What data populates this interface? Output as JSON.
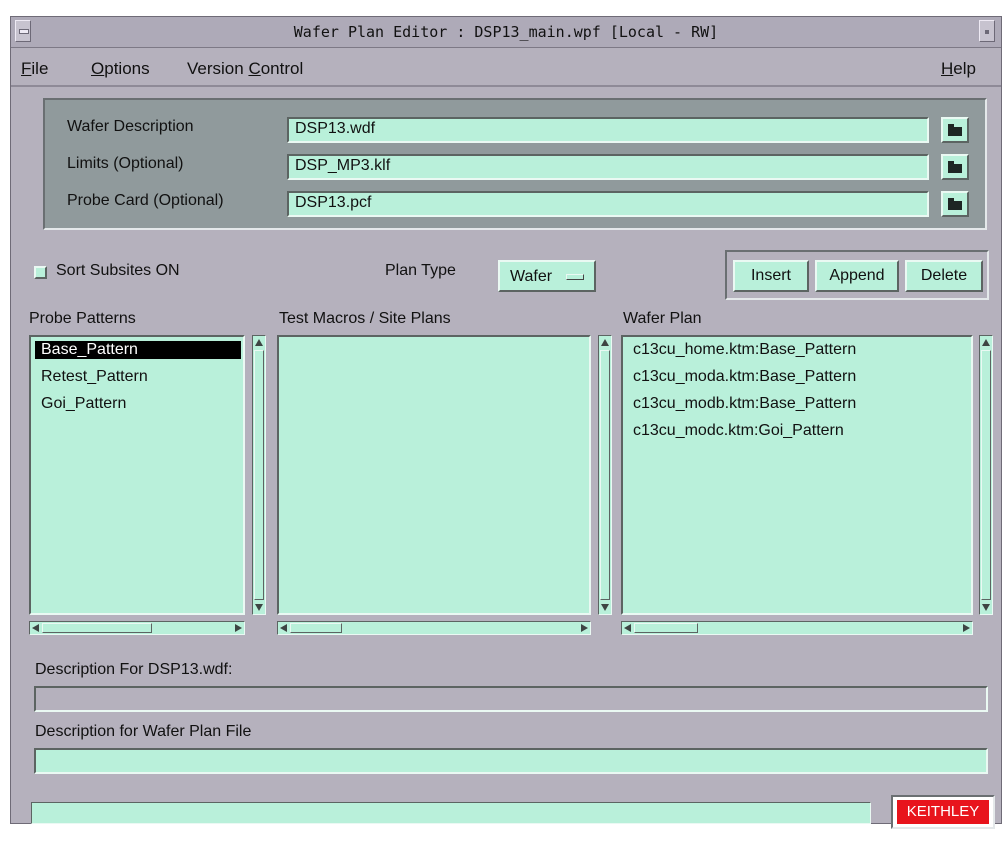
{
  "window": {
    "title": "Wafer Plan Editor : DSP13_main.wpf [Local - RW]"
  },
  "menu": {
    "file": {
      "mnemonic": "F",
      "rest": "ile"
    },
    "options": {
      "mnemonic": "O",
      "rest": "ptions"
    },
    "version_control": {
      "pre": "Version ",
      "mnemonic": "C",
      "rest": "ontrol"
    },
    "help": {
      "mnemonic": "H",
      "rest": "elp"
    }
  },
  "files": {
    "wafer_description": {
      "label": "Wafer Description",
      "value": "DSP13.wdf"
    },
    "limits": {
      "label": "Limits (Optional)",
      "value": "DSP_MP3.klf"
    },
    "probe_card": {
      "label": "Probe Card (Optional)",
      "value": "DSP13.pcf"
    }
  },
  "options": {
    "sort_subsites": {
      "label": "Sort Subsites ON",
      "checked": false
    },
    "plan_type": {
      "label": "Plan Type",
      "value": "Wafer"
    }
  },
  "buttons": {
    "insert": "Insert",
    "append": "Append",
    "delete": "Delete"
  },
  "lists": {
    "probe_patterns": {
      "header": "Probe Patterns",
      "items": [
        "Base_Pattern",
        "Retest_Pattern",
        "Goi_Pattern"
      ],
      "selected": "Base_Pattern"
    },
    "test_macros": {
      "header": "Test Macros / Site Plans",
      "items": []
    },
    "wafer_plan": {
      "header": "Wafer Plan",
      "items": [
        "c13cu_home.ktm:Base_Pattern",
        "c13cu_moda.ktm:Base_Pattern",
        "c13cu_modb.ktm:Base_Pattern",
        "c13cu_modc.ktm:Goi_Pattern"
      ]
    }
  },
  "descriptions": {
    "wafer_desc_label": "Description For DSP13.wdf:",
    "wafer_desc_value": "",
    "plan_desc_label": "Description for Wafer Plan File",
    "plan_desc_value": ""
  },
  "status": {
    "text": ""
  },
  "logo": {
    "text": "KEITHLEY"
  },
  "colors": {
    "window_bg": "#b5b1bd",
    "field_bg": "#b9f0da",
    "file_panel_bg": "#909a9c",
    "logo_red": "#e8141c"
  }
}
